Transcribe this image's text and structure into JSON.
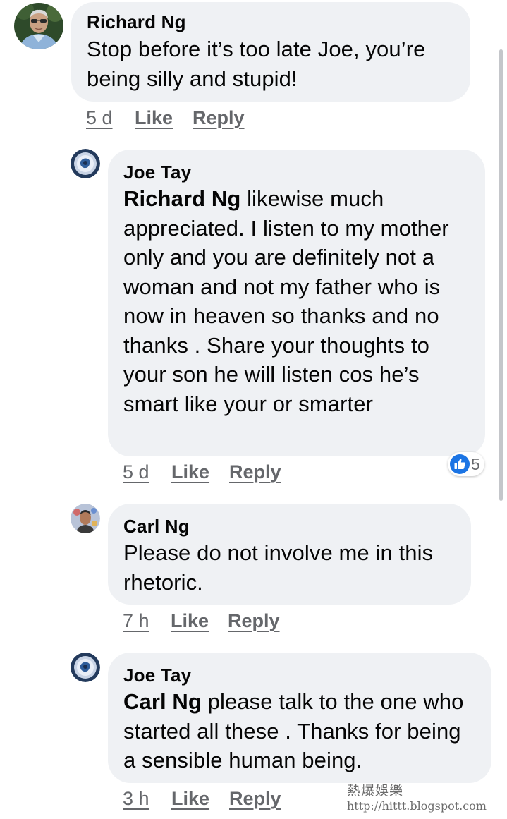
{
  "comments": [
    {
      "author": "Richard Ng",
      "text": "Stop before it’s too late Joe, you’re being silly and stupid!",
      "time": "5 d",
      "like_label": "Like",
      "reply_label": "Reply"
    },
    {
      "author": "Joe Tay",
      "mention": "Richard Ng",
      "text": " likewise much appreciated. I listen to my mother only and you are definitely not a woman and not my father who is now in heaven so thanks and no thanks . Share your thoughts to your son he will listen cos he’s smart like your or smarter",
      "time": "5 d",
      "like_label": "Like",
      "reply_label": "Reply",
      "reaction_count": "5"
    },
    {
      "author": "Carl Ng",
      "text": "Please do not involve me in this rhetoric.",
      "time": "7 h",
      "like_label": "Like",
      "reply_label": "Reply"
    },
    {
      "author": "Joe Tay",
      "mention": "Carl Ng",
      "text": " please talk to the one who started all these . Thanks for being a sensible human being.",
      "time": "3 h",
      "like_label": "Like",
      "reply_label": "Reply"
    }
  ],
  "watermark": {
    "title": "熱爆娛樂",
    "url": "http://hittt.blogspot.com"
  },
  "colors": {
    "bubble": "#eff1f4",
    "meta_text": "#65676b",
    "like_blue": "#1b74e4"
  }
}
